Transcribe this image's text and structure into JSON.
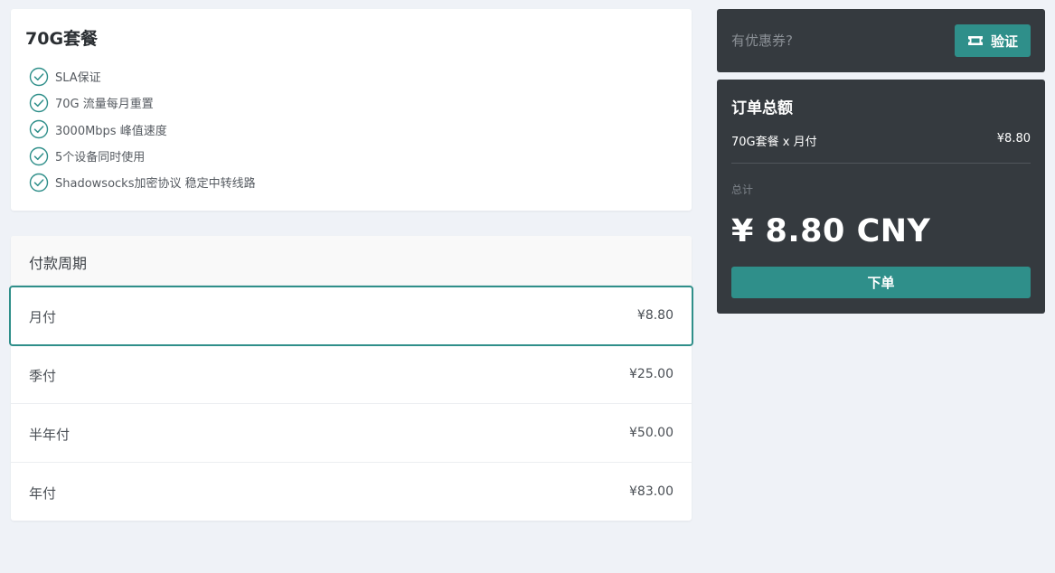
{
  "plan": {
    "title": "70G套餐",
    "features": [
      "SLA保证",
      "70G 流量每月重置",
      "3000Mbps 峰值速度",
      "5个设备同时使用",
      "Shadowsocks加密协议 稳定中转线路"
    ],
    "feature_icon": "check-circle-icon"
  },
  "period": {
    "header": "付款周期",
    "options": [
      {
        "label": "月付",
        "price": "¥8.80",
        "selected": true
      },
      {
        "label": "季付",
        "price": "¥25.00",
        "selected": false
      },
      {
        "label": "半年付",
        "price": "¥50.00",
        "selected": false
      },
      {
        "label": "年付",
        "price": "¥83.00",
        "selected": false
      }
    ]
  },
  "coupon": {
    "placeholder": "有优惠券?",
    "value": "",
    "button_label": "验证",
    "button_icon": "ticket-icon"
  },
  "summary": {
    "title": "订单总额",
    "item_label": "70G套餐 x 月付",
    "item_price": "¥8.80",
    "total_label": "总计",
    "total_amount": "¥ 8.80 CNY",
    "order_button_label": "下单"
  },
  "colors": {
    "accent": "#2f8f8a",
    "dark_panel": "#353a3f",
    "background": "#eff2f7"
  }
}
